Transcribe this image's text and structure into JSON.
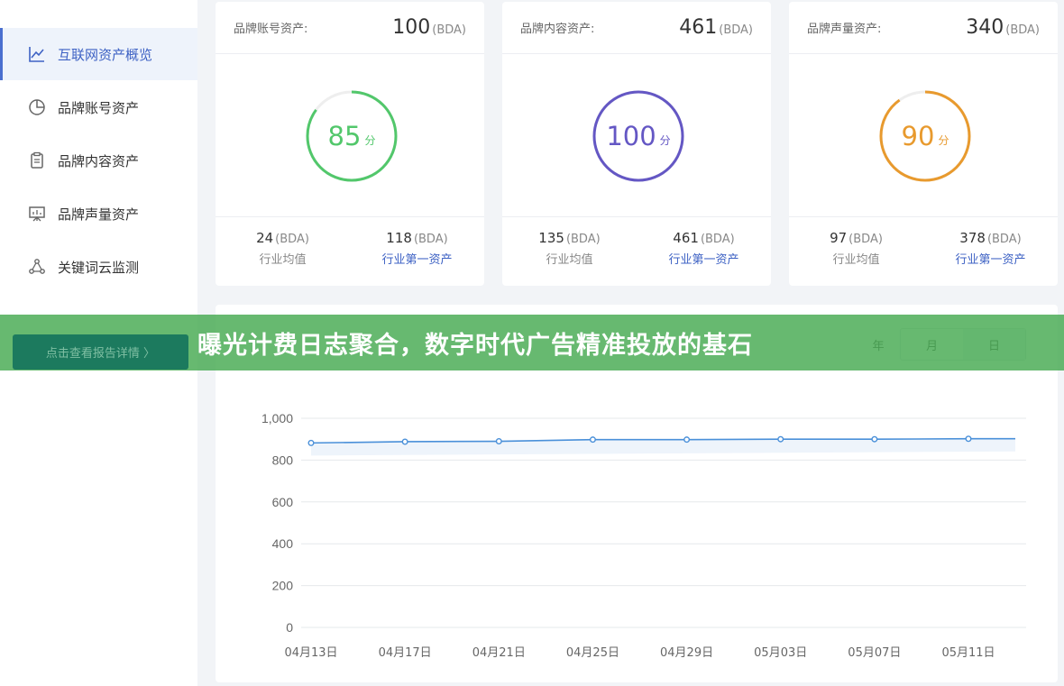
{
  "sidebar": {
    "items": [
      {
        "label": "互联网资产概览",
        "icon": "line-chart-icon",
        "active": true
      },
      {
        "label": "品牌账号资产",
        "icon": "pie-chart-icon",
        "active": false
      },
      {
        "label": "品牌内容资产",
        "icon": "clipboard-icon",
        "active": false
      },
      {
        "label": "品牌声量资产",
        "icon": "presentation-icon",
        "active": false
      },
      {
        "label": "关键词云监测",
        "icon": "network-icon",
        "active": false
      }
    ],
    "report_button": "点击查看报告详情 〉"
  },
  "cards": [
    {
      "label": "品牌账号资产:",
      "value": "100",
      "unit": "(BDA)",
      "score": "85",
      "score_unit": "分",
      "score_fraction": 0.85,
      "color": "#52c76b",
      "avg_value": "24",
      "avg_unit": "(BDA)",
      "avg_label": "行业均值",
      "top_value": "118",
      "top_unit": "(BDA)",
      "top_label": "行业第一资产"
    },
    {
      "label": "品牌内容资产:",
      "value": "461",
      "unit": "(BDA)",
      "score": "100",
      "score_unit": "分",
      "score_fraction": 1.0,
      "color": "#6457c4",
      "avg_value": "135",
      "avg_unit": "(BDA)",
      "avg_label": "行业均值",
      "top_value": "461",
      "top_unit": "(BDA)",
      "top_label": "行业第一资产"
    },
    {
      "label": "品牌声量资产:",
      "value": "340",
      "unit": "(BDA)",
      "score": "90",
      "score_unit": "分",
      "score_fraction": 0.9,
      "color": "#e89a2e",
      "avg_value": "97",
      "avg_unit": "(BDA)",
      "avg_label": "行业均值",
      "top_value": "378",
      "top_unit": "(BDA)",
      "top_label": "行业第一资产"
    }
  ],
  "chart_toggle": {
    "partial": "年",
    "options": [
      "月",
      "日"
    ],
    "active": "日"
  },
  "banner": {
    "title": "曝光计费日志聚合，数字时代广告精准投放的基石"
  },
  "chart_data": {
    "type": "line",
    "x": [
      "04月13日",
      "04月17日",
      "04月21日",
      "04月25日",
      "04月29日",
      "05月03日",
      "05月07日",
      "05月11日"
    ],
    "values": [
      882,
      888,
      890,
      898,
      898,
      900,
      900,
      902
    ],
    "ylim": [
      0,
      1000
    ],
    "yticks": [
      "0",
      "200",
      "400",
      "600",
      "800",
      "1,000"
    ],
    "grid": true,
    "line_color": "#4a90d9"
  }
}
